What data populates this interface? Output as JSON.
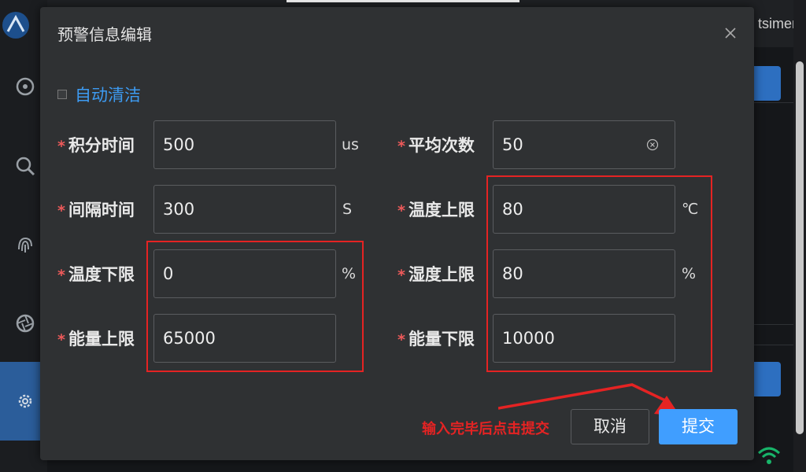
{
  "background": {
    "user_text": "tsimen"
  },
  "dialog": {
    "title": "预警信息编辑",
    "auto_clean": {
      "label": "自动清洁",
      "checked": false
    },
    "fields": {
      "integration_time": {
        "label": "积分时间",
        "value": "500",
        "unit": "us"
      },
      "average_count": {
        "label": "平均次数",
        "value": "50",
        "unit": ""
      },
      "interval_time": {
        "label": "间隔时间",
        "value": "300",
        "unit": "S"
      },
      "temp_upper": {
        "label": "温度上限",
        "value": "80",
        "unit": "℃"
      },
      "temp_lower": {
        "label": "温度下限",
        "value": "0",
        "unit": "%"
      },
      "humidity_upper": {
        "label": "湿度上限",
        "value": "80",
        "unit": "%"
      },
      "energy_upper": {
        "label": "能量上限",
        "value": "65000",
        "unit": ""
      },
      "energy_lower": {
        "label": "能量下限",
        "value": "10000",
        "unit": ""
      }
    },
    "required_mark": "*",
    "annotation_hint": "输入完毕后点击提交",
    "buttons": {
      "cancel": "取消",
      "submit": "提交"
    }
  },
  "colors": {
    "accent": "#409eff",
    "annotation": "#e52323",
    "required": "#ee5a5a"
  },
  "icons": [
    "close-icon",
    "clear-icon",
    "settings-icon",
    "wifi-icon"
  ]
}
